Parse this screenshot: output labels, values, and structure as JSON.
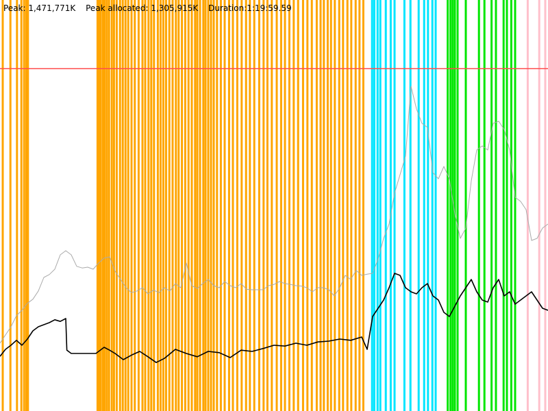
{
  "header": {
    "peak": "Peak: 1,471,771K",
    "peak_allocated": "Peak allocated: 1,305,915K",
    "duration": "Duration:1:19:59.59"
  },
  "chart_data": {
    "type": "line",
    "title": "",
    "xlabel": "",
    "ylabel": "",
    "x_range": [
      0,
      1000
    ],
    "y_range": [
      0,
      1000
    ],
    "threshold_line": {
      "y": 833,
      "color": "#ff4d4d"
    },
    "phase_colors": {
      "orange": "#ffa500",
      "cyan": "#00e5ff",
      "green": "#00e600",
      "pink": "#ffc0cb"
    },
    "phase_marks": [
      {
        "x": 5,
        "color": "orange"
      },
      {
        "x": 19,
        "color": "orange"
      },
      {
        "x": 31,
        "color": "orange"
      },
      {
        "x": 39,
        "color": "orange"
      },
      {
        "x": 44,
        "color": "orange"
      },
      {
        "x": 48,
        "color": "orange"
      },
      {
        "x": 51,
        "color": "orange"
      },
      {
        "x": 178,
        "color": "orange"
      },
      {
        "x": 181,
        "color": "orange"
      },
      {
        "x": 184,
        "color": "orange"
      },
      {
        "x": 188,
        "color": "orange"
      },
      {
        "x": 191,
        "color": "orange"
      },
      {
        "x": 195,
        "color": "orange"
      },
      {
        "x": 199,
        "color": "orange"
      },
      {
        "x": 204,
        "color": "orange"
      },
      {
        "x": 208,
        "color": "orange"
      },
      {
        "x": 213,
        "color": "orange"
      },
      {
        "x": 219,
        "color": "orange"
      },
      {
        "x": 224,
        "color": "orange"
      },
      {
        "x": 229,
        "color": "orange"
      },
      {
        "x": 234,
        "color": "orange"
      },
      {
        "x": 240,
        "color": "orange"
      },
      {
        "x": 246,
        "color": "orange"
      },
      {
        "x": 253,
        "color": "orange"
      },
      {
        "x": 260,
        "color": "orange"
      },
      {
        "x": 265,
        "color": "orange"
      },
      {
        "x": 271,
        "color": "orange"
      },
      {
        "x": 276,
        "color": "orange"
      },
      {
        "x": 281,
        "color": "orange"
      },
      {
        "x": 288,
        "color": "orange"
      },
      {
        "x": 293,
        "color": "orange"
      },
      {
        "x": 298,
        "color": "orange"
      },
      {
        "x": 303,
        "color": "orange"
      },
      {
        "x": 309,
        "color": "orange"
      },
      {
        "x": 315,
        "color": "orange"
      },
      {
        "x": 321,
        "color": "orange"
      },
      {
        "x": 326,
        "color": "orange"
      },
      {
        "x": 332,
        "color": "orange"
      },
      {
        "x": 338,
        "color": "orange"
      },
      {
        "x": 344,
        "color": "orange"
      },
      {
        "x": 350,
        "color": "orange"
      },
      {
        "x": 356,
        "color": "orange"
      },
      {
        "x": 360,
        "color": "orange"
      },
      {
        "x": 365,
        "color": "orange"
      },
      {
        "x": 371,
        "color": "orange"
      },
      {
        "x": 375,
        "color": "orange"
      },
      {
        "x": 380,
        "color": "orange"
      },
      {
        "x": 385,
        "color": "orange"
      },
      {
        "x": 390,
        "color": "orange"
      },
      {
        "x": 396,
        "color": "orange"
      },
      {
        "x": 403,
        "color": "orange"
      },
      {
        "x": 410,
        "color": "orange"
      },
      {
        "x": 418,
        "color": "orange"
      },
      {
        "x": 425,
        "color": "orange"
      },
      {
        "x": 433,
        "color": "orange"
      },
      {
        "x": 441,
        "color": "orange"
      },
      {
        "x": 449,
        "color": "orange"
      },
      {
        "x": 456,
        "color": "orange"
      },
      {
        "x": 464,
        "color": "orange"
      },
      {
        "x": 473,
        "color": "orange"
      },
      {
        "x": 481,
        "color": "orange"
      },
      {
        "x": 488,
        "color": "orange"
      },
      {
        "x": 496,
        "color": "orange"
      },
      {
        "x": 505,
        "color": "orange"
      },
      {
        "x": 513,
        "color": "orange"
      },
      {
        "x": 520,
        "color": "orange"
      },
      {
        "x": 528,
        "color": "orange"
      },
      {
        "x": 536,
        "color": "orange"
      },
      {
        "x": 544,
        "color": "orange"
      },
      {
        "x": 553,
        "color": "orange"
      },
      {
        "x": 561,
        "color": "orange"
      },
      {
        "x": 569,
        "color": "orange"
      },
      {
        "x": 578,
        "color": "orange"
      },
      {
        "x": 585,
        "color": "orange"
      },
      {
        "x": 591,
        "color": "orange"
      },
      {
        "x": 598,
        "color": "orange"
      },
      {
        "x": 604,
        "color": "orange"
      },
      {
        "x": 611,
        "color": "orange"
      },
      {
        "x": 619,
        "color": "orange"
      },
      {
        "x": 626,
        "color": "orange"
      },
      {
        "x": 634,
        "color": "orange"
      },
      {
        "x": 641,
        "color": "orange"
      },
      {
        "x": 649,
        "color": "orange"
      },
      {
        "x": 656,
        "color": "orange"
      },
      {
        "x": 663,
        "color": "orange"
      },
      {
        "x": 679,
        "color": "cyan"
      },
      {
        "x": 683,
        "color": "cyan"
      },
      {
        "x": 689,
        "color": "cyan"
      },
      {
        "x": 694,
        "color": "cyan"
      },
      {
        "x": 704,
        "color": "cyan"
      },
      {
        "x": 713,
        "color": "cyan"
      },
      {
        "x": 720,
        "color": "cyan"
      },
      {
        "x": 738,
        "color": "cyan"
      },
      {
        "x": 749,
        "color": "cyan"
      },
      {
        "x": 764,
        "color": "cyan"
      },
      {
        "x": 774,
        "color": "cyan"
      },
      {
        "x": 781,
        "color": "cyan"
      },
      {
        "x": 789,
        "color": "cyan"
      },
      {
        "x": 795,
        "color": "cyan"
      },
      {
        "x": 817,
        "color": "green"
      },
      {
        "x": 822,
        "color": "green"
      },
      {
        "x": 826,
        "color": "green"
      },
      {
        "x": 830,
        "color": "green"
      },
      {
        "x": 835,
        "color": "green"
      },
      {
        "x": 850,
        "color": "green"
      },
      {
        "x": 874,
        "color": "green"
      },
      {
        "x": 884,
        "color": "green"
      },
      {
        "x": 897,
        "color": "green"
      },
      {
        "x": 905,
        "color": "green"
      },
      {
        "x": 919,
        "color": "green"
      },
      {
        "x": 925,
        "color": "green"
      },
      {
        "x": 933,
        "color": "green"
      },
      {
        "x": 940,
        "color": "green"
      },
      {
        "x": 963,
        "color": "pink"
      },
      {
        "x": 984,
        "color": "pink"
      },
      {
        "x": 995,
        "color": "pink"
      }
    ],
    "series": [
      {
        "color": "#000000",
        "values": [
          [
            0,
            133
          ],
          [
            10,
            150
          ],
          [
            20,
            160
          ],
          [
            30,
            172
          ],
          [
            40,
            160
          ],
          [
            50,
            175
          ],
          [
            60,
            195
          ],
          [
            70,
            205
          ],
          [
            80,
            210
          ],
          [
            90,
            215
          ],
          [
            100,
            222
          ],
          [
            110,
            218
          ],
          [
            120,
            225
          ],
          [
            122,
            148
          ],
          [
            130,
            140
          ],
          [
            175,
            140
          ],
          [
            180,
            145
          ],
          [
            190,
            155
          ],
          [
            200,
            148
          ],
          [
            210,
            140
          ],
          [
            225,
            125
          ],
          [
            240,
            136
          ],
          [
            255,
            145
          ],
          [
            270,
            132
          ],
          [
            285,
            118
          ],
          [
            300,
            128
          ],
          [
            320,
            150
          ],
          [
            340,
            140
          ],
          [
            360,
            132
          ],
          [
            380,
            145
          ],
          [
            400,
            142
          ],
          [
            420,
            130
          ],
          [
            440,
            148
          ],
          [
            460,
            145
          ],
          [
            480,
            152
          ],
          [
            500,
            160
          ],
          [
            520,
            158
          ],
          [
            540,
            165
          ],
          [
            560,
            160
          ],
          [
            580,
            168
          ],
          [
            600,
            170
          ],
          [
            620,
            175
          ],
          [
            640,
            172
          ],
          [
            660,
            180
          ],
          [
            670,
            150
          ],
          [
            680,
            230
          ],
          [
            690,
            250
          ],
          [
            700,
            270
          ],
          [
            710,
            300
          ],
          [
            720,
            335
          ],
          [
            730,
            330
          ],
          [
            740,
            300
          ],
          [
            750,
            290
          ],
          [
            760,
            285
          ],
          [
            770,
            300
          ],
          [
            780,
            310
          ],
          [
            790,
            280
          ],
          [
            800,
            270
          ],
          [
            810,
            240
          ],
          [
            820,
            230
          ],
          [
            830,
            255
          ],
          [
            840,
            280
          ],
          [
            850,
            300
          ],
          [
            860,
            320
          ],
          [
            870,
            290
          ],
          [
            880,
            270
          ],
          [
            890,
            265
          ],
          [
            900,
            300
          ],
          [
            910,
            320
          ],
          [
            920,
            280
          ],
          [
            930,
            290
          ],
          [
            940,
            260
          ],
          [
            950,
            270
          ],
          [
            960,
            280
          ],
          [
            970,
            290
          ],
          [
            980,
            270
          ],
          [
            990,
            250
          ],
          [
            1000,
            245
          ]
        ]
      },
      {
        "color": "#aaaaaa",
        "values": [
          [
            0,
            165
          ],
          [
            10,
            185
          ],
          [
            20,
            205
          ],
          [
            30,
            232
          ],
          [
            40,
            245
          ],
          [
            50,
            262
          ],
          [
            60,
            272
          ],
          [
            70,
            292
          ],
          [
            80,
            325
          ],
          [
            90,
            332
          ],
          [
            100,
            345
          ],
          [
            110,
            380
          ],
          [
            120,
            390
          ],
          [
            130,
            380
          ],
          [
            140,
            352
          ],
          [
            150,
            348
          ],
          [
            160,
            350
          ],
          [
            170,
            345
          ],
          [
            180,
            360
          ],
          [
            190,
            372
          ],
          [
            200,
            375
          ],
          [
            210,
            340
          ],
          [
            220,
            320
          ],
          [
            230,
            300
          ],
          [
            240,
            288
          ],
          [
            250,
            292
          ],
          [
            260,
            300
          ],
          [
            270,
            285
          ],
          [
            280,
            294
          ],
          [
            290,
            288
          ],
          [
            300,
            300
          ],
          [
            310,
            292
          ],
          [
            320,
            310
          ],
          [
            330,
            300
          ],
          [
            340,
            360
          ],
          [
            350,
            305
          ],
          [
            360,
            298
          ],
          [
            370,
            310
          ],
          [
            380,
            320
          ],
          [
            390,
            305
          ],
          [
            400,
            300
          ],
          [
            410,
            315
          ],
          [
            420,
            305
          ],
          [
            430,
            300
          ],
          [
            440,
            310
          ],
          [
            450,
            296
          ],
          [
            460,
            295
          ],
          [
            470,
            295
          ],
          [
            480,
            295
          ],
          [
            490,
            305
          ],
          [
            500,
            308
          ],
          [
            510,
            315
          ],
          [
            520,
            310
          ],
          [
            530,
            308
          ],
          [
            540,
            305
          ],
          [
            550,
            304
          ],
          [
            560,
            300
          ],
          [
            570,
            290
          ],
          [
            580,
            300
          ],
          [
            590,
            300
          ],
          [
            600,
            295
          ],
          [
            610,
            280
          ],
          [
            620,
            300
          ],
          [
            630,
            330
          ],
          [
            640,
            320
          ],
          [
            650,
            342
          ],
          [
            660,
            330
          ],
          [
            670,
            333
          ],
          [
            680,
            335
          ],
          [
            690,
            370
          ],
          [
            700,
            420
          ],
          [
            710,
            455
          ],
          [
            720,
            530
          ],
          [
            730,
            575
          ],
          [
            740,
            620
          ],
          [
            750,
            790
          ],
          [
            760,
            735
          ],
          [
            770,
            700
          ],
          [
            780,
            690
          ],
          [
            790,
            580
          ],
          [
            800,
            565
          ],
          [
            810,
            595
          ],
          [
            820,
            565
          ],
          [
            830,
            480
          ],
          [
            840,
            420
          ],
          [
            850,
            445
          ],
          [
            860,
            560
          ],
          [
            870,
            635
          ],
          [
            880,
            645
          ],
          [
            890,
            635
          ],
          [
            900,
            700
          ],
          [
            910,
            705
          ],
          [
            920,
            685
          ],
          [
            930,
            635
          ],
          [
            940,
            520
          ],
          [
            950,
            510
          ],
          [
            960,
            490
          ],
          [
            970,
            415
          ],
          [
            980,
            420
          ],
          [
            990,
            445
          ],
          [
            1000,
            455
          ]
        ]
      }
    ]
  }
}
